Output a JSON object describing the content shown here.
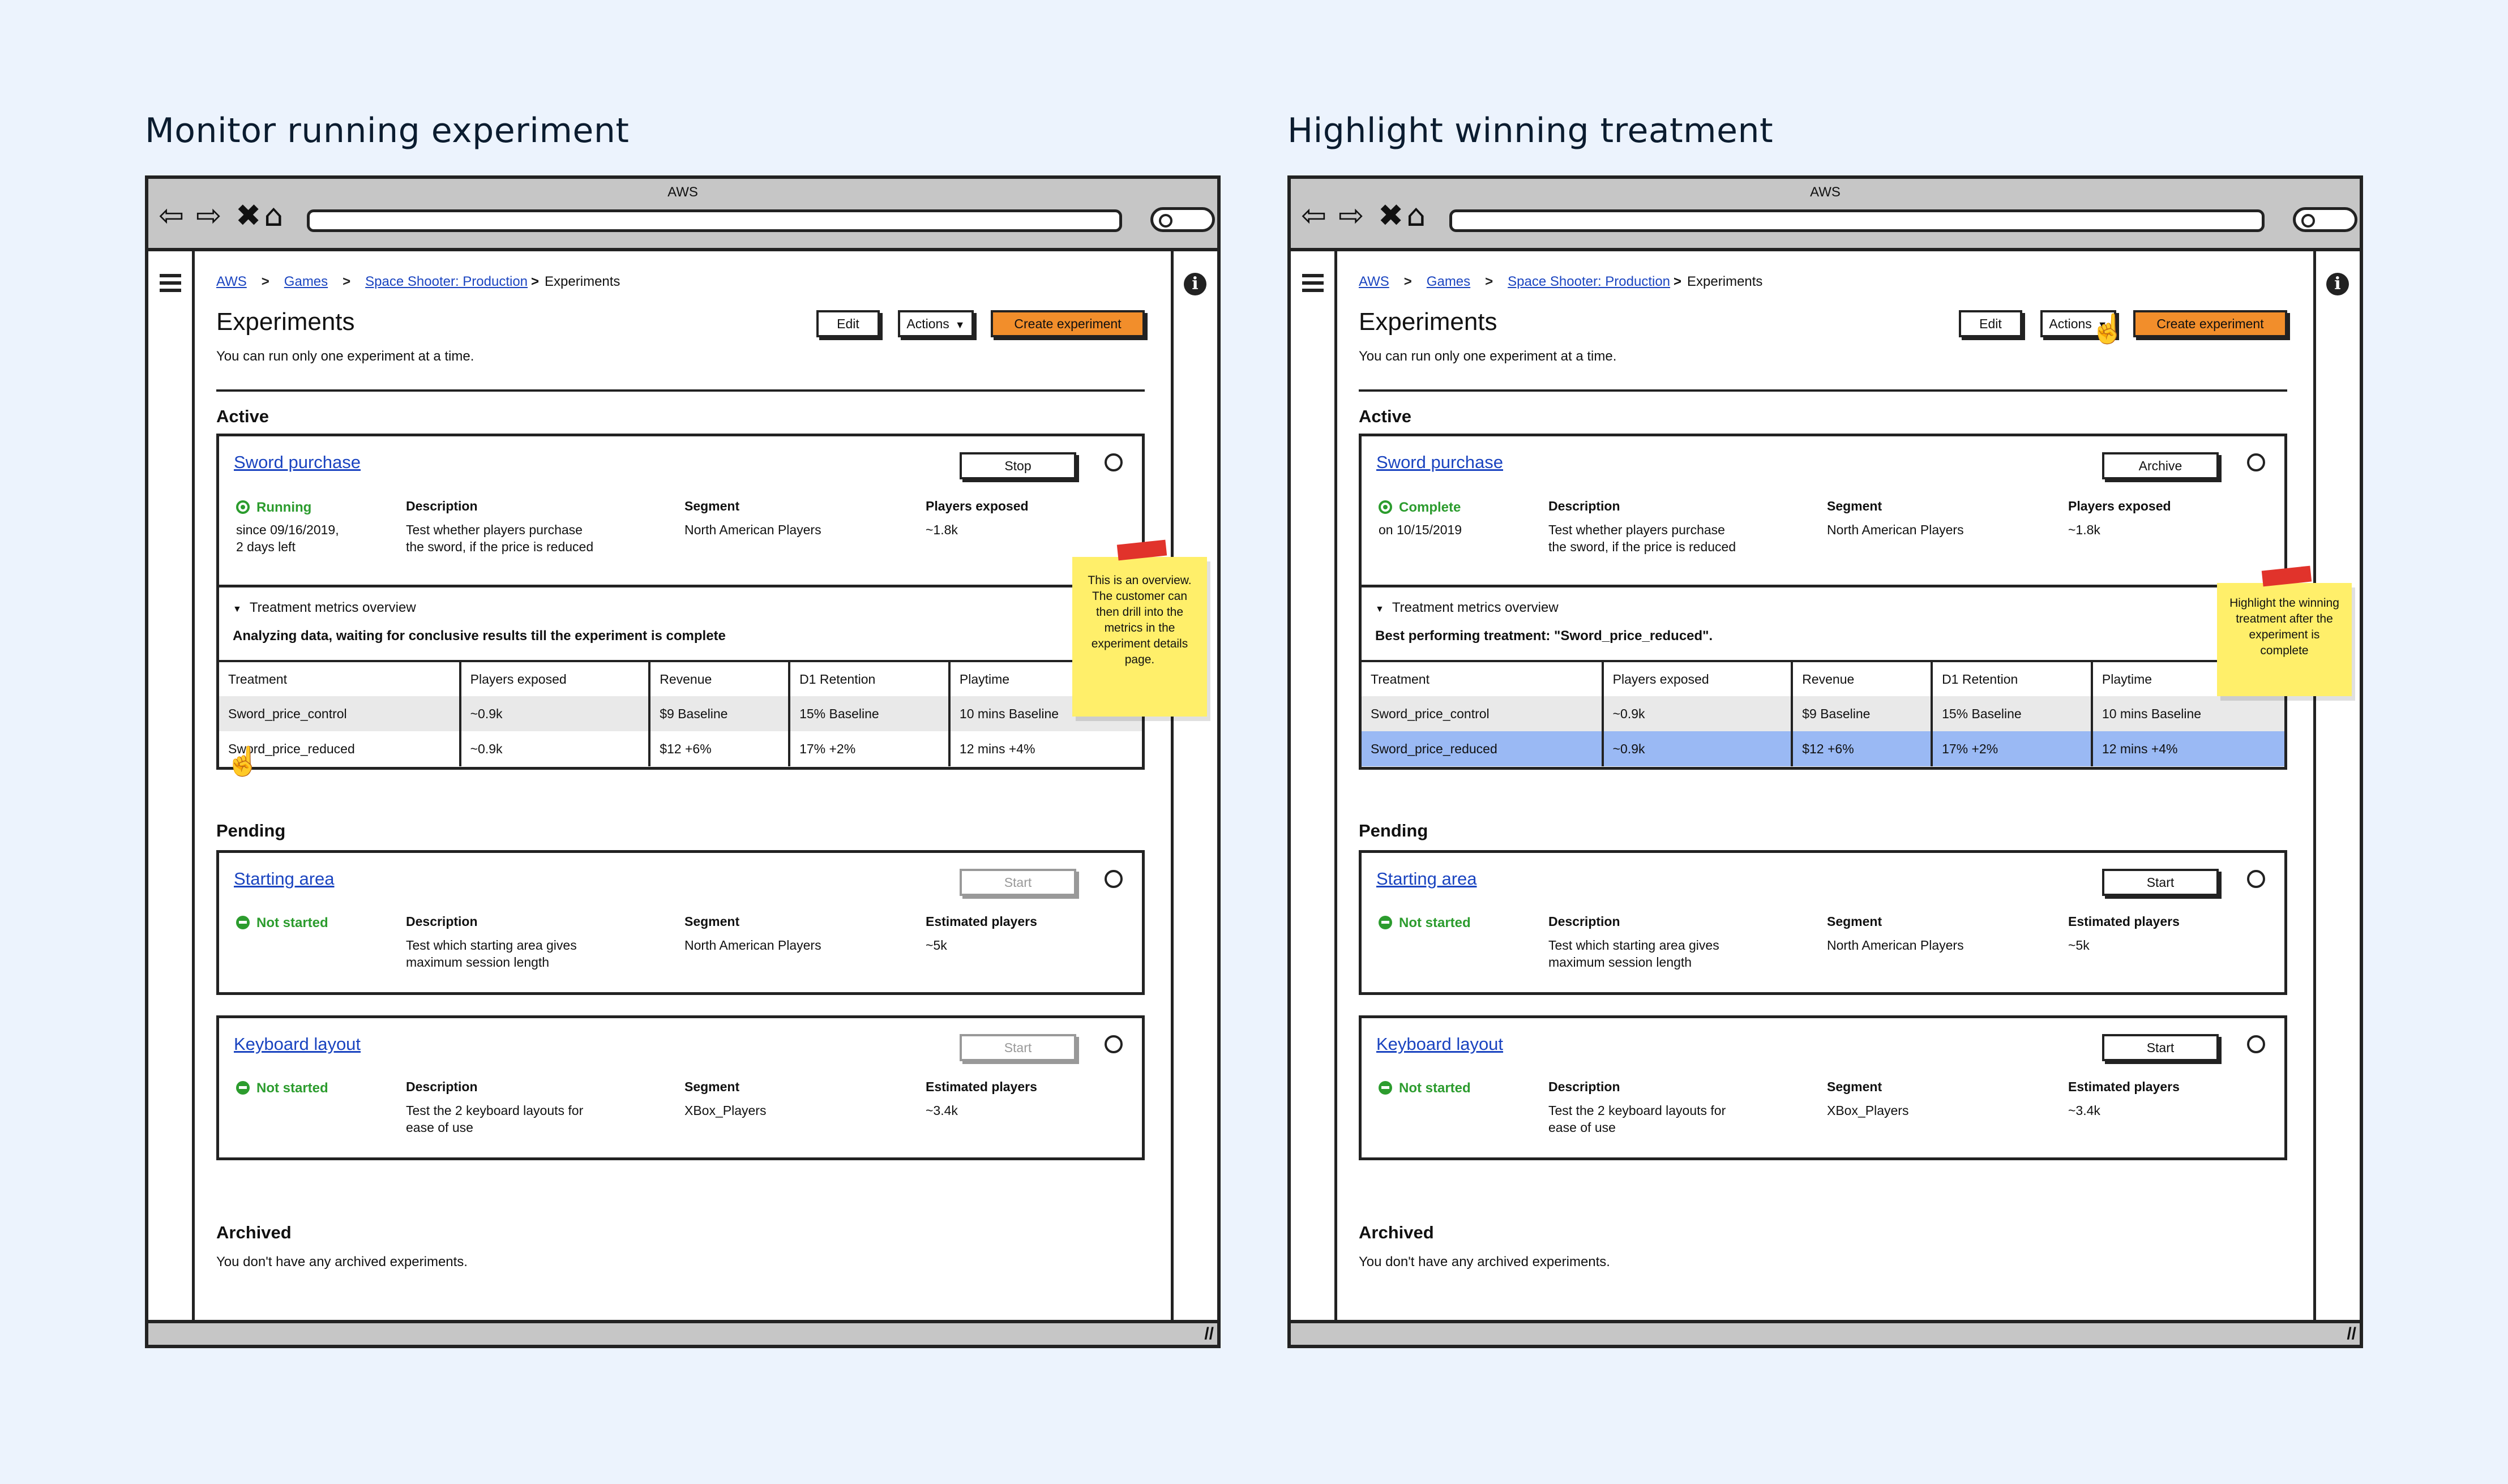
{
  "panels": [
    {
      "heading": "Monitor running experiment",
      "chrome_title": "AWS",
      "breadcrumb": [
        "AWS",
        "Games",
        "Space Shooter: Production",
        "Experiments"
      ],
      "title": "Experiments",
      "subtitle": "You can run only one experiment at a time.",
      "buttons": {
        "edit": "Edit",
        "actions": "Actions",
        "create": "Create experiment"
      },
      "active": {
        "section": "Active",
        "name": "Sword purchase",
        "action": "Stop",
        "status": "Running",
        "status_sub": [
          "since 09/16/2019,",
          "2 days left"
        ],
        "desc_label": "Description",
        "desc": [
          "Test whether players purchase",
          "the sword, if the price is reduced"
        ],
        "seg_label": "Segment",
        "seg": "North American Players",
        "players_label": "Players exposed",
        "players": "~1.8k",
        "metrics_toggle": "Treatment metrics overview",
        "metrics_msg": "Analyzing data, waiting for conclusive results till the experiment is complete",
        "table": {
          "headers": [
            "Treatment",
            "Players exposed",
            "Revenue",
            "D1 Retention",
            "Playtime"
          ],
          "rows": [
            [
              "Sword_price_control",
              "~0.9k",
              "$9 Baseline",
              "15% Baseline",
              "10 mins Baseline"
            ],
            [
              "Sword_price_reduced",
              "~0.9k",
              "$12 +6%",
              "17% +2%",
              "12 mins +4%"
            ]
          ]
        }
      },
      "sticky": "This is an overview. The customer can then drill into the metrics in the experiment details page.",
      "pending": {
        "section": "Pending",
        "cards": [
          {
            "name": "Starting area",
            "action": "Start",
            "status": "Not started",
            "desc": [
              "Test which starting area gives",
              "maximum session length"
            ],
            "seg": "North American Players",
            "players_label": "Estimated players",
            "players": "~5k"
          },
          {
            "name": "Keyboard layout",
            "action": "Start",
            "status": "Not started",
            "desc": [
              "Test the 2 keyboard layouts for",
              "ease of use"
            ],
            "seg": "XBox_Players",
            "players_label": "Estimated players",
            "players": "~3.4k"
          }
        ]
      },
      "archived": {
        "section": "Archived",
        "text": "You don't have any archived experiments."
      }
    },
    {
      "heading": "Highlight winning treatment",
      "chrome_title": "AWS",
      "breadcrumb": [
        "AWS",
        "Games",
        "Space Shooter: Production",
        "Experiments"
      ],
      "title": "Experiments",
      "subtitle": "You can run only one experiment at a time.",
      "buttons": {
        "edit": "Edit",
        "actions": "Actions",
        "create": "Create experiment"
      },
      "active": {
        "section": "Active",
        "name": "Sword purchase",
        "action": "Archive",
        "status": "Complete",
        "status_sub": [
          "on 10/15/2019"
        ],
        "desc_label": "Description",
        "desc": [
          "Test whether players purchase",
          "the sword, if the price is reduced"
        ],
        "seg_label": "Segment",
        "seg": "North American Players",
        "players_label": "Players exposed",
        "players": "~1.8k",
        "metrics_toggle": "Treatment metrics overview",
        "metrics_msg": "Best performing treatment: \"Sword_price_reduced\".",
        "table": {
          "headers": [
            "Treatment",
            "Players exposed",
            "Revenue",
            "D1 Retention",
            "Playtime"
          ],
          "rows": [
            [
              "Sword_price_control",
              "~0.9k",
              "$9 Baseline",
              "15% Baseline",
              "10 mins Baseline"
            ],
            [
              "Sword_price_reduced",
              "~0.9k",
              "$12 +6%",
              "17% +2%",
              "12 mins +4%"
            ]
          ]
        }
      },
      "sticky": "Highlight the winning treatment after the experiment is complete",
      "pending": {
        "section": "Pending",
        "cards": [
          {
            "name": "Starting area",
            "action": "Start",
            "status": "Not started",
            "desc": [
              "Test which starting area gives",
              "maximum session length"
            ],
            "seg": "North American Players",
            "players_label": "Estimated players",
            "players": "~5k"
          },
          {
            "name": "Keyboard layout",
            "action": "Start",
            "status": "Not started",
            "desc": [
              "Test the 2 keyboard layouts for",
              "ease of use"
            ],
            "seg": "XBox_Players",
            "players_label": "Estimated players",
            "players": "~3.4k"
          }
        ]
      },
      "archived": {
        "section": "Archived",
        "text": "You don't have any archived experiments."
      }
    }
  ],
  "colors": {
    "link": "#1a44c0",
    "primary": "#f28e2b",
    "success": "#2c9c2e",
    "highlight": "#9ab9f4",
    "sticky": "#ffef6a",
    "tape": "#e1332b",
    "background": "#ecf3fd"
  },
  "icons": [
    "back-arrow-icon",
    "forward-arrow-icon",
    "close-icon",
    "home-icon",
    "search-icon",
    "hamburger-icon",
    "info-icon",
    "resize-icon",
    "cursor-hand-icon"
  ]
}
